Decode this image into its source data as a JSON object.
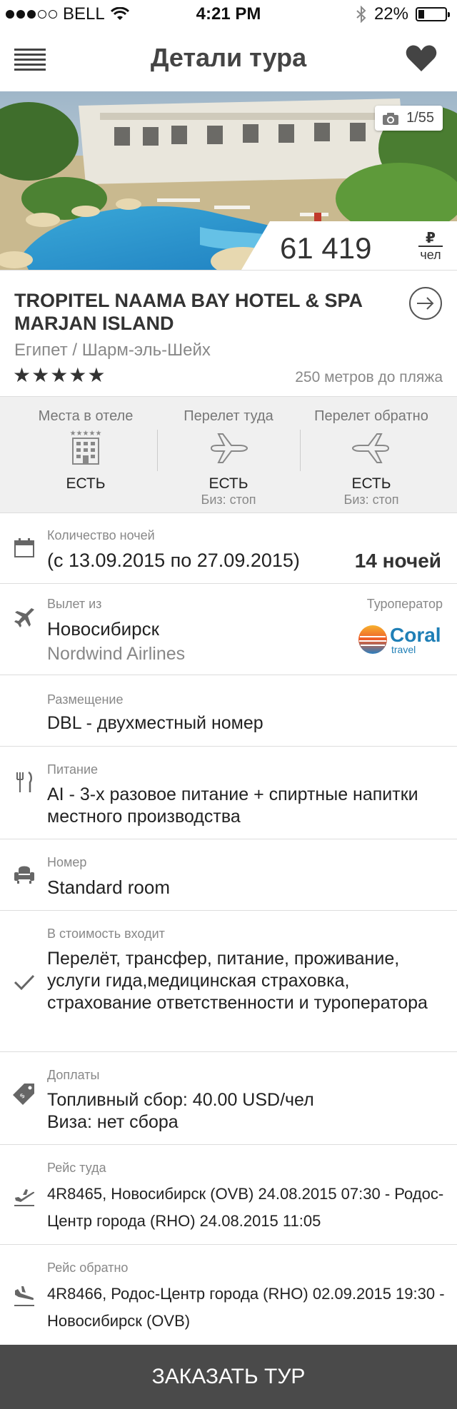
{
  "status_bar": {
    "carrier": "BELL",
    "time": "4:21 PM",
    "battery": "22%"
  },
  "header": {
    "title": "Детали тура"
  },
  "hero": {
    "photo_counter": "1/55",
    "price": "61 419",
    "currency": "₽",
    "per": "чел"
  },
  "hotel": {
    "name": "TROPITEL NAAMA BAY HOTEL & SPA MARJAN ISLAND",
    "location": "Египет / Шарм-эль-Шейх",
    "stars": "★★★★★",
    "beach_distance": "250 метров до пляжа"
  },
  "availability": [
    {
      "label": "Места в отеле",
      "value": "ЕСТЬ",
      "sub": "",
      "icon": "hotel-icon"
    },
    {
      "label": "Перелет туда",
      "value": "ЕСТЬ",
      "sub": "Биз: стоп",
      "icon": "plane-icon"
    },
    {
      "label": "Перелет обратно",
      "value": "ЕСТЬ",
      "sub": "Биз: стоп",
      "icon": "plane-icon"
    }
  ],
  "nights": {
    "label": "Количество ночей",
    "dates": "(с 13.09.2015 по 27.09.2015)",
    "count": "14 ночей"
  },
  "departure": {
    "label": "Вылет из",
    "city": "Новосибирск",
    "airline": "Nordwind Airlines",
    "operator_label": "Туроператор",
    "operator_logo": "Coral",
    "operator_logo_sub": "travel"
  },
  "accommodation": {
    "label": "Размещение",
    "value": "DBL - двухместный номер"
  },
  "meals": {
    "label": "Питание",
    "value": "AI - 3-х разовое питание + спиртные напитки местного производства"
  },
  "room": {
    "label": "Номер",
    "value": "Standard room"
  },
  "included": {
    "label": "В стоимость входит",
    "value": "Перелёт, трансфер, питание, проживание, услуги гида,медицинская страховка, страхование ответственности и туроператора"
  },
  "extras": {
    "label": "Доплаты",
    "fuel": "Топливный сбор: 40.00 USD/чел",
    "visa": "Виза: нет сбора"
  },
  "flight_out": {
    "label": "Рейс туда",
    "value": "4R8465, Новосибирск (OVB) 24.08.2015 07:30 - Родос-Центр города (RHO) 24.08.2015 11:05"
  },
  "flight_back": {
    "label": "Рейс обратно",
    "value": "4R8466, Родос-Центр города (RHO) 02.09.2015 19:30 - Новосибирск (OVB)"
  },
  "order_button": "ЗАКАЗАТЬ ТУР",
  "colors": {
    "accent_dark": "#4a4a4a",
    "text": "#222222",
    "muted": "#888888"
  }
}
